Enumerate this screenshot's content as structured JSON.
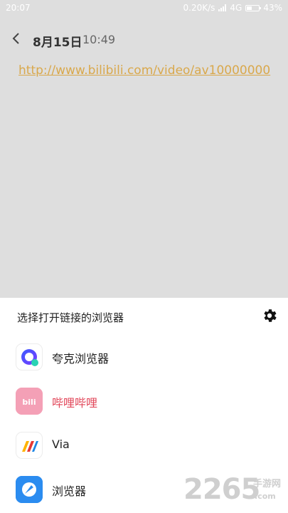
{
  "status_bar": {
    "time": "20:07",
    "speed": "0.20K/s",
    "network": "4G",
    "battery": "43%"
  },
  "header": {
    "date": "8月15日",
    "time": "10:49"
  },
  "message": {
    "link": "http://www.bilibili.com/video/av10000000"
  },
  "sheet": {
    "title": "选择打开链接的浏览器",
    "items": [
      {
        "label": "夸克浏览器",
        "icon": "quark-browser-icon"
      },
      {
        "label": "哔哩哔哩",
        "icon": "bilibili-icon",
        "color": "#e2475a"
      },
      {
        "label": "Via",
        "icon": "via-browser-icon"
      },
      {
        "label": "浏览器",
        "icon": "mi-browser-icon"
      }
    ]
  },
  "watermark": {
    "number": "2265",
    "sub": "手游网",
    "domain": ".com"
  }
}
